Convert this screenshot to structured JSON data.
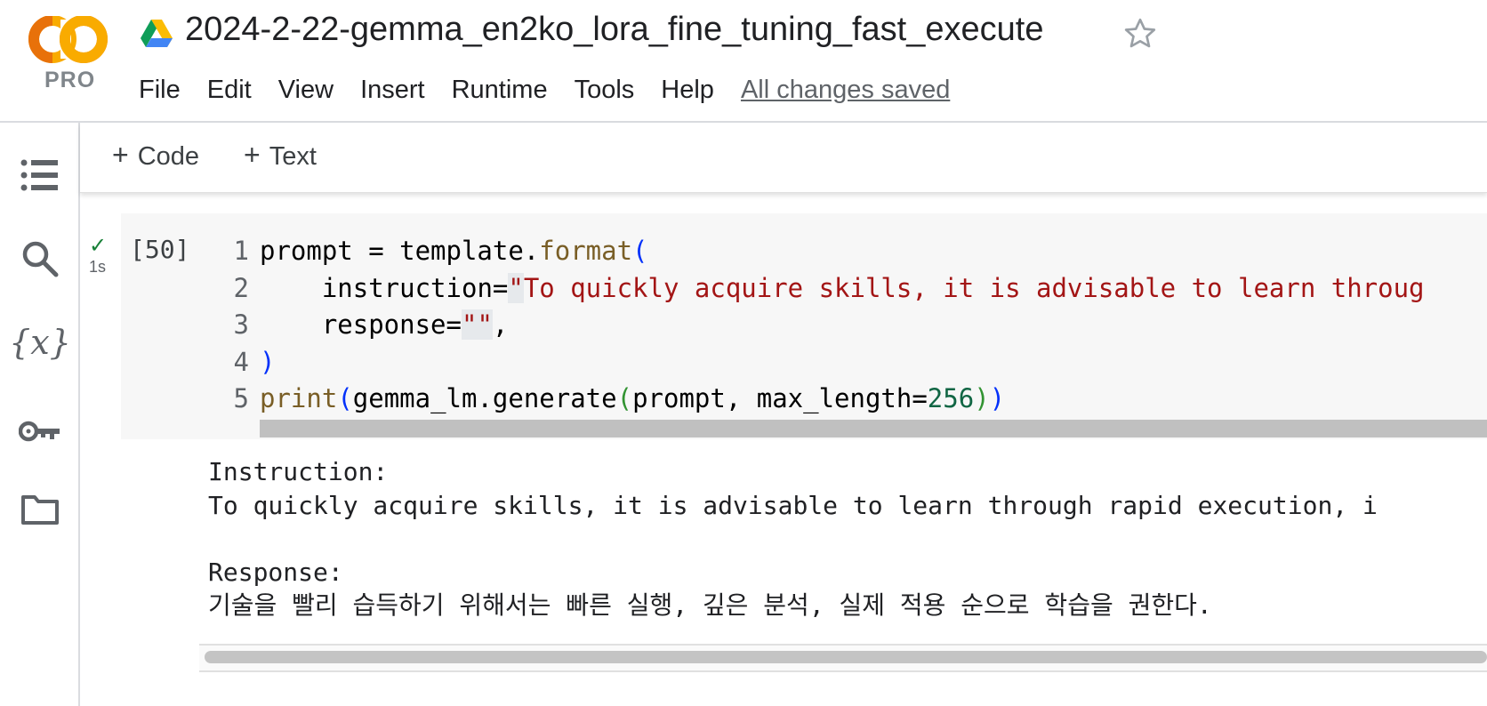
{
  "app": {
    "logo_text": "CO",
    "plan_badge": "PRO",
    "notebook_title": "2024-2-22-gemma_en2ko_lora_fine_tuning_fast_execute"
  },
  "menu": {
    "items": [
      "File",
      "Edit",
      "View",
      "Insert",
      "Runtime",
      "Tools",
      "Help"
    ],
    "save_status": "All changes saved"
  },
  "sidebar": {
    "icons": [
      "table-of-contents-icon",
      "search-icon",
      "variables-icon",
      "secrets-key-icon",
      "files-folder-icon"
    ],
    "variables_label": "{x}"
  },
  "toolbar": {
    "add_code_label": "Code",
    "add_text_label": "Text",
    "plus": "+"
  },
  "cell": {
    "execution_count": "[50]",
    "status_check": "✓",
    "duration": "1s",
    "line_numbers": [
      "1",
      "2",
      "3",
      "4",
      "5"
    ],
    "code": {
      "l1_a": "prompt = template.",
      "l1_fn": "format",
      "l1_paren": "(",
      "l2_indent": "    ",
      "l2_key": "instruction",
      "l2_eq": "=",
      "l2_quote": "\"",
      "l2_str": "To quickly acquire skills, it is advisable to learn throug",
      "l3_key": "response",
      "l3_eq": "=",
      "l3_str": "\"\"",
      "l3_comma": ",",
      "l4": ")",
      "l5_fn": "print",
      "l5_p1": "(",
      "l5_mid": "gemma_lm.generate",
      "l5_p2": "(",
      "l5_args": "prompt, max_length=",
      "l5_num": "256",
      "l5_close2": ")",
      "l5_close1": ")"
    }
  },
  "output": {
    "lines": [
      "Instruction:",
      "To quickly acquire skills, it is advisable to learn through rapid execution, i",
      "",
      "Response:",
      "기술을 빨리 습득하기 위해서는 빠른 실행, 깊은 분석, 실제 적용 순으로 학습을 권한다."
    ]
  }
}
